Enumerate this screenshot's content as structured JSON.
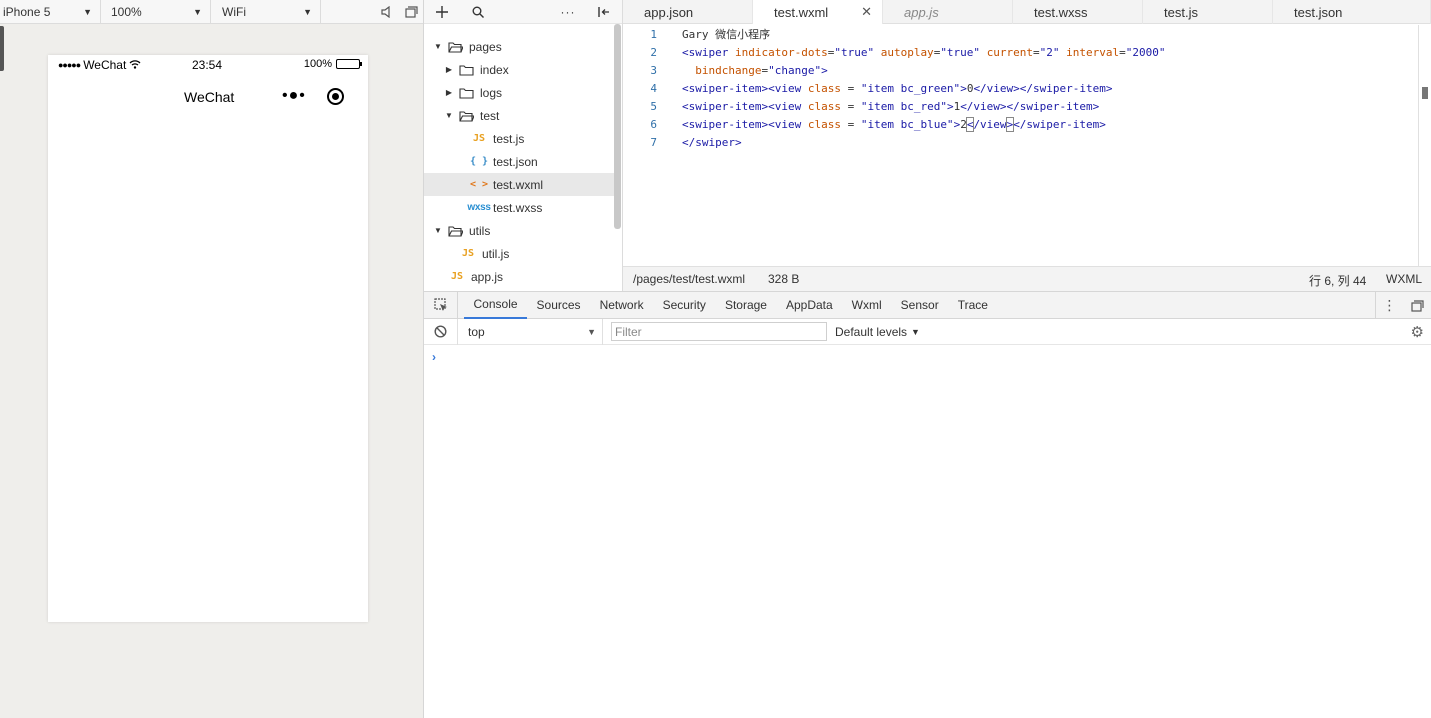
{
  "simulator": {
    "device": "iPhone 5",
    "zoom": "100%",
    "network": "WiFi",
    "status": {
      "carrier": "WeChat",
      "time": "23:54",
      "battery": "100%"
    },
    "nav_title": "WeChat",
    "nav_more": "•●•"
  },
  "tree": {
    "items": [
      {
        "label": "pages",
        "type": "folder"
      },
      {
        "label": "index",
        "type": "folder"
      },
      {
        "label": "logs",
        "type": "folder"
      },
      {
        "label": "test",
        "type": "folder"
      },
      {
        "label": "test.js",
        "type": "js"
      },
      {
        "label": "test.json",
        "type": "json"
      },
      {
        "label": "test.wxml",
        "type": "wxml"
      },
      {
        "label": "test.wxss",
        "type": "wxss"
      },
      {
        "label": "utils",
        "type": "folder"
      },
      {
        "label": "util.js",
        "type": "js"
      },
      {
        "label": "app.js",
        "type": "js"
      }
    ],
    "icon_js": "JS",
    "icon_json": "{ }",
    "icon_wxml": "< >",
    "icon_wxss": "wxss"
  },
  "editor": {
    "tabs": [
      {
        "label": "app.json"
      },
      {
        "label": "test.wxml"
      },
      {
        "label": "app.js"
      },
      {
        "label": "test.wxss"
      },
      {
        "label": "test.js"
      },
      {
        "label": "test.json"
      }
    ],
    "active_tab": 1,
    "line_numbers": [
      "1",
      "2",
      "3",
      "4",
      "5",
      "6",
      "7"
    ],
    "code": {
      "l1": "Gary 微信小程序",
      "l2_tag": "<swiper",
      "l2_a1": "indicator-dots",
      "l2_v1": "\"true\"",
      "l2_a2": "autoplay",
      "l2_v2": "\"true\"",
      "l2_a3": "current",
      "l2_v3": "\"2\"",
      "l2_a4": "interval",
      "l2_v4": "\"2000\"",
      "l3_a": "bindchange",
      "l3_v": "\"change\"",
      "l3_end": ">",
      "open_item": "<swiper-item><view",
      "class_attr": "class",
      "l4_v": "\"item bc_green\"",
      "l4_c": "0",
      "close_view": "</view>",
      "close_item": "</swiper-item>",
      "l5_v": "\"item bc_red\"",
      "l5_c": "1",
      "l6_v": "\"item bc_blue\"",
      "l6_c": "2",
      "l6_cv_a": "<",
      "l6_cv_b": "/view",
      "l6_cv_c": ">",
      "l7": "</swiper>"
    },
    "status": {
      "path": "/pages/test/test.wxml",
      "size": "328 B",
      "position": "行 6, 列 44",
      "language": "WXML"
    }
  },
  "devtools": {
    "tabs": [
      "Console",
      "Sources",
      "Network",
      "Security",
      "Storage",
      "AppData",
      "Wxml",
      "Sensor",
      "Trace"
    ],
    "active_tab": "Console",
    "context": "top",
    "filter_placeholder": "Filter",
    "levels": "Default levels",
    "prompt": "›"
  }
}
